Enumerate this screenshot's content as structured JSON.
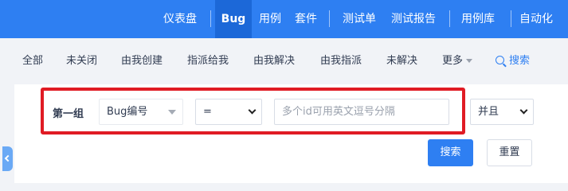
{
  "topnav": {
    "items": [
      "仪表盘",
      "Bug",
      "用例",
      "套件",
      "测试单",
      "测试报告",
      "用例库",
      "自动化"
    ],
    "active": "Bug"
  },
  "subnav": {
    "links": [
      "全部",
      "未关闭",
      "由我创建",
      "指派给我",
      "由我解决",
      "由我指派",
      "未解决"
    ],
    "more_label": "更多",
    "search_label": "搜索"
  },
  "search_form": {
    "group_label": "第一组",
    "field_value": "Bug编号",
    "operator_value": "=",
    "input_placeholder": "多个id可用英文逗号分隔",
    "logic_value": "并且",
    "search_button": "搜索",
    "reset_button": "重置"
  },
  "colors": {
    "accent": "#2e7ff2",
    "highlight": "#e01b24"
  }
}
